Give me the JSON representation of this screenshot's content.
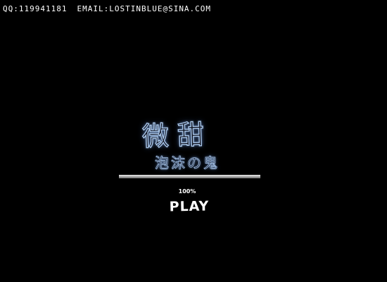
{
  "header": {
    "qq": "QQ:119941181",
    "email": "EMAIL:LOSTINBLUE@SINA.COM"
  },
  "logo": {
    "title": "微甜",
    "subtitle": "泡沫の鬼"
  },
  "loader": {
    "progress_fraction": 1.0,
    "percent_label": "100%"
  },
  "play_button": {
    "label": "PLAY"
  },
  "colors": {
    "background": "#000000",
    "text": "#ffffff",
    "logo_glow": "#a9c6e8",
    "progress_fill": "#b0b0b0"
  }
}
